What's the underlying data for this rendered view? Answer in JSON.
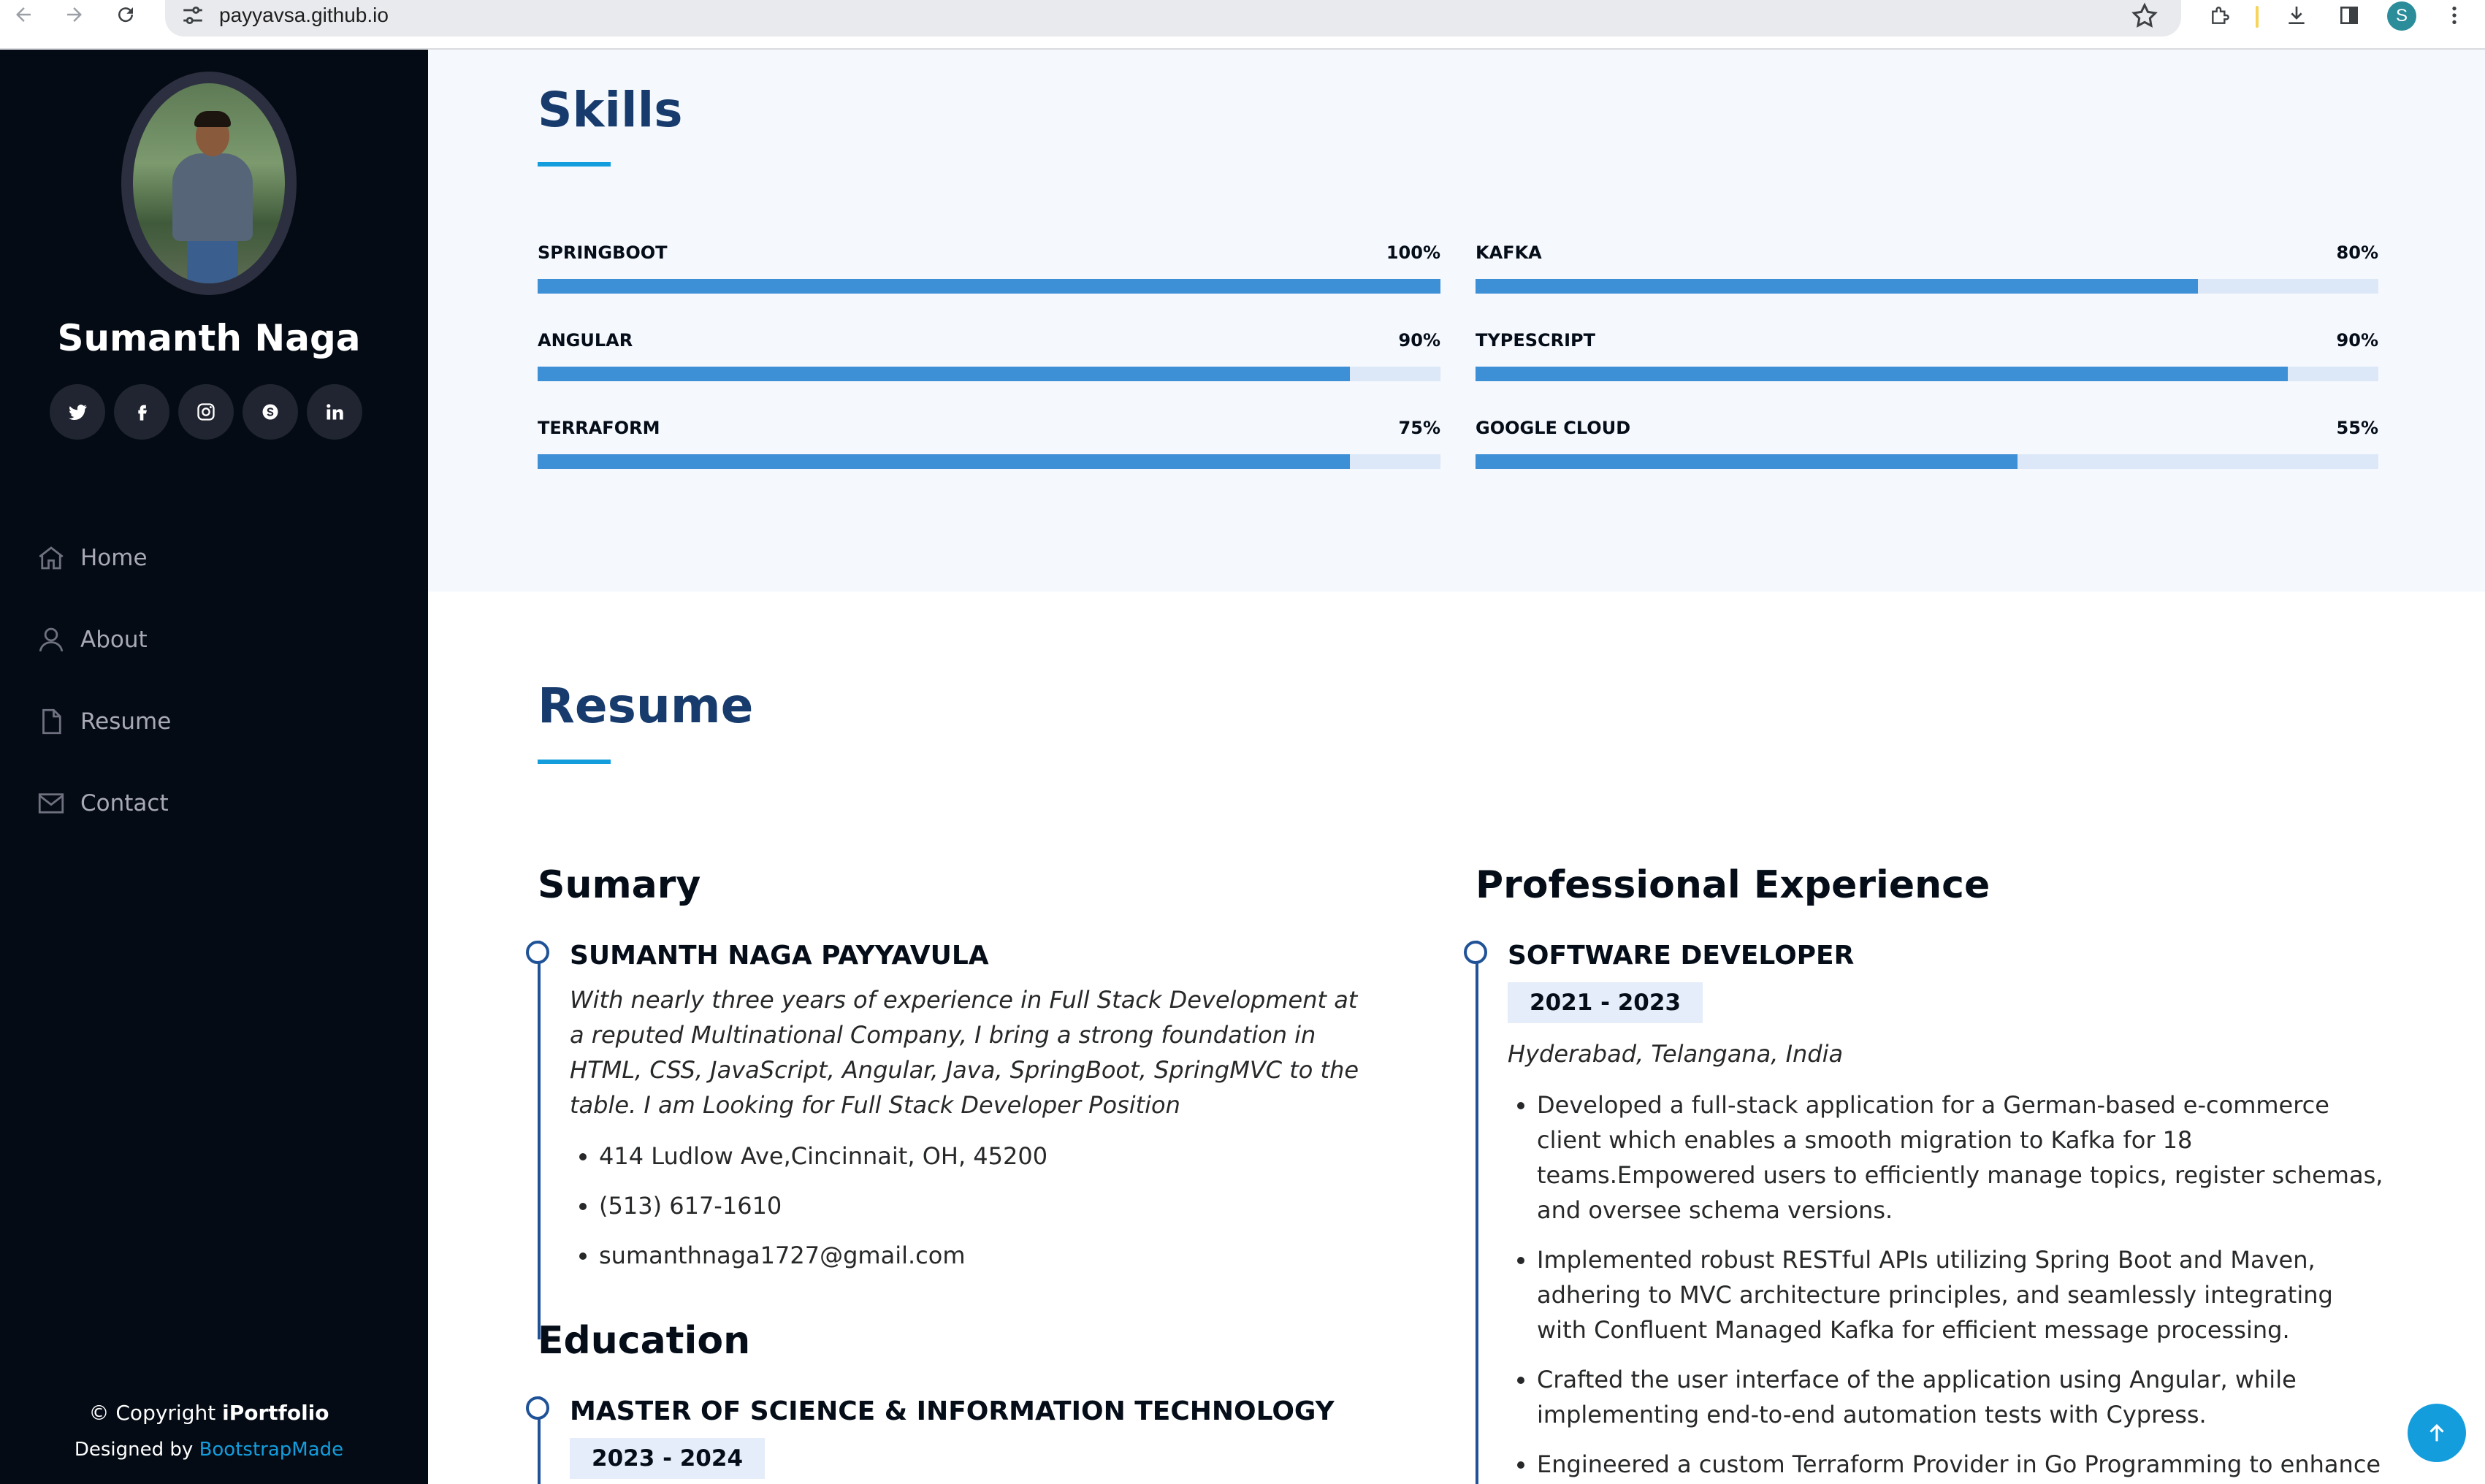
{
  "browser": {
    "url": "payyavsa.github.io",
    "profile_initial": "S"
  },
  "sidebar": {
    "name": "Sumanth Naga",
    "socials": [
      "twitter-icon",
      "facebook-icon",
      "instagram-icon",
      "skype-icon",
      "linkedin-icon"
    ],
    "menu": [
      {
        "label": "Home",
        "icon": "home-icon"
      },
      {
        "label": "About",
        "icon": "user-icon"
      },
      {
        "label": "Resume",
        "icon": "file-icon"
      },
      {
        "label": "Contact",
        "icon": "envelope-icon"
      }
    ],
    "footer": {
      "copyright_prefix": "© Copyright ",
      "brand": "iPortfolio",
      "designed_prefix": "Designed by ",
      "designer": "BootstrapMade"
    }
  },
  "skills": {
    "title": "Skills",
    "items": [
      {
        "name": "SPRINGBOOT",
        "percent_label": "100%",
        "fill": 1.0
      },
      {
        "name": "KAFKA",
        "percent_label": "80%",
        "fill": 0.8
      },
      {
        "name": "ANGULAR",
        "percent_label": "90%",
        "fill": 0.9
      },
      {
        "name": "TYPESCRIPT",
        "percent_label": "90%",
        "fill": 0.9
      },
      {
        "name": "TERRAFORM",
        "percent_label": "75%",
        "fill": 0.9
      },
      {
        "name": "GOOGLE CLOUD",
        "percent_label": "55%",
        "fill": 0.6
      }
    ]
  },
  "resume": {
    "title": "Resume",
    "summary": {
      "heading": "Sumary",
      "name": "SUMANTH NAGA PAYYAVULA",
      "text": "With nearly three years of experience in Full Stack Development at a reputed Multinational Company, I bring a strong foundation in HTML, CSS, JavaScript, Angular, Java, SpringBoot, SpringMVC to the table. I am Looking for Full Stack Developer Position",
      "contacts": [
        "414 Ludlow Ave,Cincinnait, OH, 45200",
        "(513) 617-1610",
        "sumanthnaga1727@gmail.com"
      ]
    },
    "education": {
      "heading": "Education",
      "degree": "MASTER OF SCIENCE & INFORMATION TECHNOLOGY",
      "years": "2023 - 2024"
    },
    "experience": {
      "heading": "Professional Experience",
      "role": "SOFTWARE DEVELOPER",
      "years": "2021 - 2023",
      "location": "Hyderabad, Telangana, India",
      "bullets": [
        "Developed a full-stack application for a German-based e-commerce client which enables a smooth migration to Kafka for 18 teams.Empowered users to efficiently manage topics, register schemas, and oversee schema versions.",
        "Implemented robust RESTful APIs utilizing Spring Boot and Maven, adhering to MVC architecture principles, and seamlessly integrating with Confluent Managed Kafka for efficient message processing.",
        "Crafted the user interface of the application using Angular, while implementing end-to-end automation tests with Cypress.",
        "Engineered a custom Terraform Provider in Go Programming to enhance the application's infrastructure provisioning capabilities."
      ]
    }
  }
}
